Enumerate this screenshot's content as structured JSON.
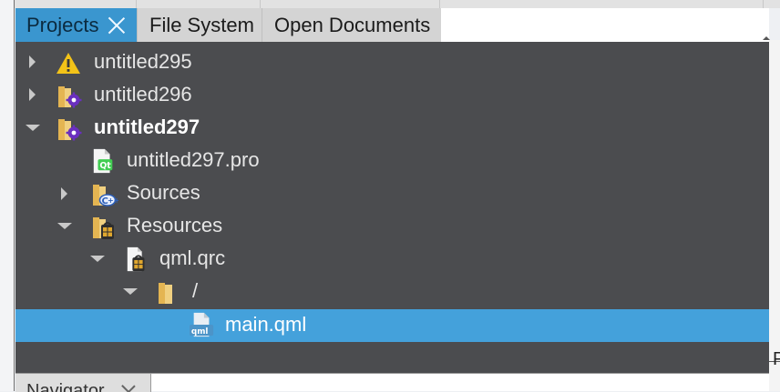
{
  "tabs": [
    {
      "label": "Projects",
      "active": true
    },
    {
      "label": "File System",
      "active": false
    },
    {
      "label": "Open Documents",
      "active": false
    }
  ],
  "tree": [
    {
      "label": "untitled295",
      "icon": "warning-icon",
      "expanded": false,
      "level": 0
    },
    {
      "label": "untitled296",
      "icon": "project-folder-icon",
      "expanded": false,
      "level": 0
    },
    {
      "label": "untitled297",
      "icon": "project-folder-icon",
      "expanded": true,
      "level": 0,
      "active_project": true
    },
    {
      "label": "untitled297.pro",
      "icon": "qt-project-file-icon",
      "level": 1
    },
    {
      "label": "Sources",
      "icon": "cpp-sources-folder-icon",
      "expanded": false,
      "level": 1
    },
    {
      "label": "Resources",
      "icon": "resources-folder-icon",
      "expanded": true,
      "level": 1
    },
    {
      "label": "qml.qrc",
      "icon": "resource-file-icon",
      "expanded": true,
      "level": 2
    },
    {
      "label": "/",
      "icon": "folder-icon",
      "expanded": true,
      "level": 3
    },
    {
      "label": "main.qml",
      "icon": "qml-file-icon",
      "level": 4,
      "selected": true
    }
  ],
  "bottom_panel": {
    "tab_label": "Navigator"
  },
  "right_edge_char": "P",
  "colors": {
    "active_tab": "#3a96cf",
    "tree_background": "#4b4c4f",
    "selection": "#44a1db"
  }
}
